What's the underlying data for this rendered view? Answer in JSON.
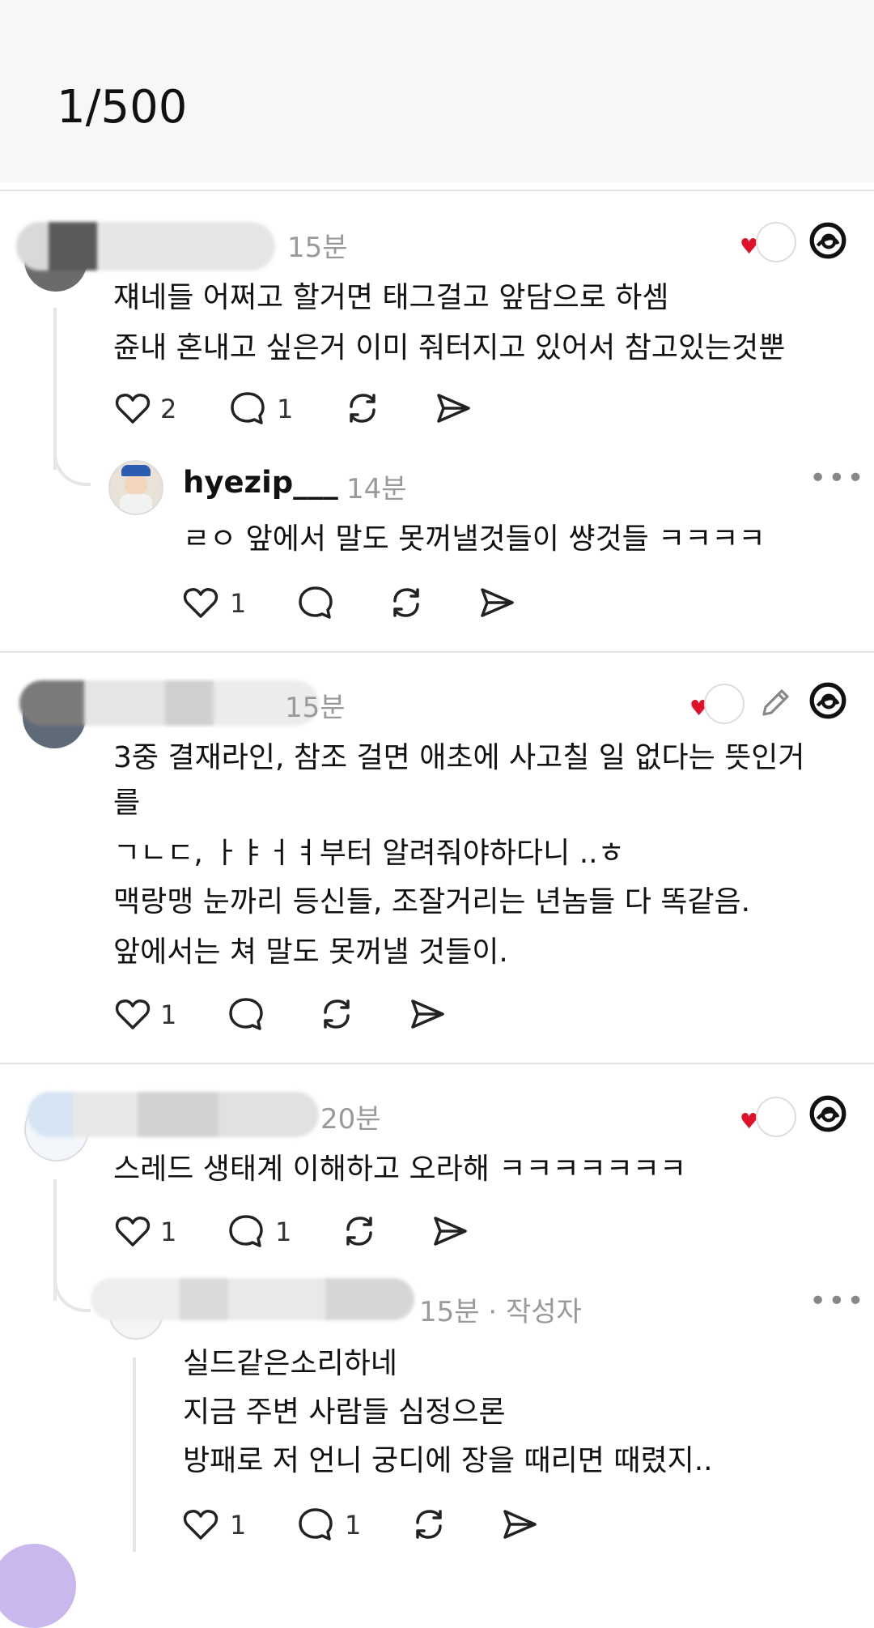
{
  "header": {
    "counter": "1/500"
  },
  "posts": [
    {
      "time": "15분",
      "lines": [
        "쟤네들 어쩌고 할거면 태그걸고 앞담으로 하셈",
        "쥰내 혼내고 싶은거 이미 줘터지고 있어서 참고있는것뿐"
      ],
      "likes": "2",
      "replies": "1",
      "reply": {
        "username": "hyezip___",
        "time": "14분",
        "lines": [
          "ㄹㅇ 앞에서 말도 못꺼낼것들이 썅것들 ㅋㅋㅋㅋ"
        ],
        "likes": "1"
      }
    },
    {
      "time": "15분",
      "lines": [
        "3중 결재라인, 참조 걸면 애초에 사고칠 일 없다는 뜻인거",
        "를",
        "ㄱㄴㄷ, ㅏㅑㅓㅕ부터 알려줘야하다니 ..ㅎ",
        "맥랑맹 눈까리 등신들, 조잘거리는 년놈들 다 똑같음.",
        "앞에서는 쳐 말도 못꺼낼 것들이."
      ],
      "likes": "1"
    },
    {
      "time": "20분",
      "lines": [
        "스레드 생태계 이해하고 오라해 ㅋㅋㅋㅋㅋㅋㅋ"
      ],
      "likes": "1",
      "replies": "1",
      "reply": {
        "time": "15분 · 작성자",
        "lines": [
          "실드같은소리하네",
          "지금 주변 사람들 심정으론",
          "방패로 저 언니 궁디에 장을 때리면 때렸지.."
        ],
        "likes": "1",
        "replies": "1"
      }
    }
  ],
  "icons": [
    "heart-icon",
    "comment-icon",
    "repost-icon",
    "share-icon",
    "threads-logo-icon",
    "pencil-icon",
    "more-icon"
  ],
  "colors": {
    "heart_badge": "#e0112b",
    "muted": "#9a9a9a",
    "divider": "#e4e4e4"
  }
}
